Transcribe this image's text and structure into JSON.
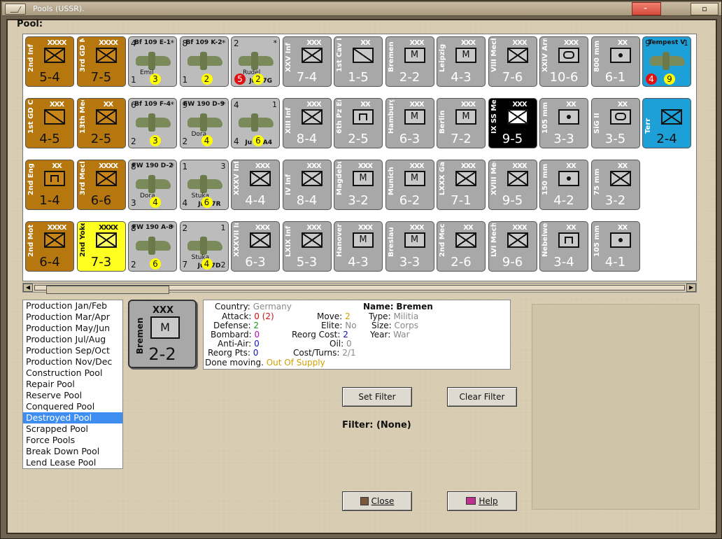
{
  "window": {
    "title": "Pools (USSR)."
  },
  "pool_header": "Pool:",
  "rows": [
    [
      {
        "t": "unit",
        "color": "c-brown",
        "size": "XXXX",
        "name": "2nd Inf",
        "sym": "x",
        "stats": "5-4"
      },
      {
        "t": "unit",
        "color": "c-brown",
        "size": "XXXX",
        "name": "3rd GD Mot",
        "sym": "x",
        "stats": "7-5"
      },
      {
        "t": "air",
        "name": "Bf 109\nE-1",
        "tl": "4",
        "tr": "*",
        "bl": "1",
        "an2": "Emil",
        "dot": "3",
        "dotc": "dy"
      },
      {
        "t": "air",
        "name": "Bf 109\nK-2",
        "tl": "8",
        "tr": "*",
        "bl": "1",
        "dot": "2",
        "dotc": "dy"
      },
      {
        "t": "air",
        "name": "",
        "tl": "2",
        "tr": "*",
        "bl": "",
        "an2": "Rudel",
        "an3": "Ju 87G",
        "dot": "2",
        "dotc": "dy",
        "dot2": "5",
        "dot2c": "dr"
      },
      {
        "t": "unit",
        "color": "c-gray",
        "size": "XXX",
        "name": "XXV Inf",
        "sym": "x",
        "stats": "7-4"
      },
      {
        "t": "unit",
        "color": "c-gray",
        "size": "XX",
        "name": "1st Cav Div",
        "sym": "slash",
        "stats": "1-5"
      },
      {
        "t": "unit",
        "color": "c-gray",
        "size": "XXX",
        "name": "Bremen",
        "sym": "m",
        "stats": "2-2"
      },
      {
        "t": "unit",
        "color": "c-gray",
        "size": "XXX",
        "name": "Leipzig",
        "sym": "m",
        "stats": "4-3"
      },
      {
        "t": "unit",
        "color": "c-gray",
        "size": "XXX",
        "name": "VIII Mech",
        "sym": "x",
        "stats": "7-6"
      },
      {
        "t": "unit",
        "color": "c-gray",
        "size": "XXX",
        "name": "XXIV Arm",
        "sym": "o",
        "stats": "10-6"
      },
      {
        "t": "unit",
        "color": "c-gray",
        "size": "XX",
        "name": "800 mm G.",
        "sym": "dot",
        "stats": "6-1"
      },
      {
        "t": "air",
        "color": "c-blue",
        "name": "Tempest\nV",
        "tl": "9",
        "tr": "1",
        "dot": "9",
        "dotc": "dy",
        "dot2": "4",
        "dot2c": "dr"
      }
    ],
    [
      {
        "t": "unit",
        "color": "c-brown",
        "size": "XXX",
        "name": "1st GD Cav",
        "sym": "slash",
        "stats": "4-5"
      },
      {
        "t": "unit",
        "color": "c-brown",
        "size": "XX",
        "name": "13th Mech.",
        "sym": "x",
        "stats": "2-5"
      },
      {
        "t": "air",
        "name": "Bf 109\nF-4",
        "tl": "6",
        "tr": "*",
        "bl": "2",
        "dot": "3",
        "dotc": "dy"
      },
      {
        "t": "air",
        "name": "FW 190\nD-9",
        "tl": "9",
        "tr": "*",
        "bl": "2",
        "an2": "Dora",
        "dot": "4",
        "dotc": "dy"
      },
      {
        "t": "air",
        "name": "",
        "tl": "4",
        "tr": "1",
        "bl": "4",
        "an3": "Ju 88A4",
        "dot": "6",
        "dotc": "dy"
      },
      {
        "t": "unit",
        "color": "c-gray",
        "size": "XXX",
        "name": "XIII Inf",
        "sym": "x",
        "stats": "8-4"
      },
      {
        "t": "unit",
        "color": "c-gray",
        "size": "XX",
        "name": "6th Pz Eng",
        "sym": "e",
        "stats": "2-5"
      },
      {
        "t": "unit",
        "color": "c-gray",
        "size": "XXX",
        "name": "Hamburg",
        "sym": "m",
        "stats": "6-3"
      },
      {
        "t": "unit",
        "color": "c-gray",
        "size": "XXX",
        "name": "Berlin",
        "sym": "m",
        "stats": "7-2"
      },
      {
        "t": "unit",
        "color": "c-black",
        "size": "XXX",
        "name": "IX SS Mech",
        "sym": "x",
        "stats": "9-5"
      },
      {
        "t": "unit",
        "color": "c-gray",
        "size": "XX",
        "name": "105 mm",
        "sym": "dot",
        "stats": "3-3"
      },
      {
        "t": "unit",
        "color": "c-gray",
        "size": "XX",
        "name": "SiG II",
        "sym": "o",
        "stats": "3-5"
      },
      {
        "t": "unit",
        "color": "c-blue",
        "size": "",
        "name": "Terr",
        "sym": "x",
        "stats": "2-4"
      }
    ],
    [
      {
        "t": "unit",
        "color": "c-brown",
        "size": "XX",
        "name": "2nd Eng",
        "sym": "e",
        "stats": "1-4"
      },
      {
        "t": "unit",
        "color": "c-brown",
        "size": "XXXX",
        "name": "3rd Mech",
        "sym": "x",
        "stats": "6-6"
      },
      {
        "t": "air",
        "name": "FW 190\nD-2",
        "tl": "8",
        "tr": "*",
        "bl": "3",
        "an2": "Dora",
        "dot": "4",
        "dotc": "dy"
      },
      {
        "t": "air",
        "name": "",
        "tl": "1",
        "tr": "3",
        "bl": "4",
        "an2": "Stuka",
        "an3": "Ju 87R",
        "dot": "6",
        "dotc": "dy"
      },
      {
        "t": "unit",
        "color": "c-gray",
        "size": "XXX",
        "name": "XXXV Inf",
        "sym": "x",
        "stats": "4-4"
      },
      {
        "t": "unit",
        "color": "c-gray",
        "size": "XXX",
        "name": "IV Inf",
        "sym": "x",
        "stats": "8-4"
      },
      {
        "t": "unit",
        "color": "c-gray",
        "size": "XXX",
        "name": "Magdeburg",
        "sym": "m",
        "stats": "3-2"
      },
      {
        "t": "unit",
        "color": "c-gray",
        "size": "XXX",
        "name": "Munich",
        "sym": "m",
        "stats": "6-2"
      },
      {
        "t": "unit",
        "color": "c-gray",
        "size": "XXX",
        "name": "LXXX Garr",
        "sym": "x",
        "stats": "7-1"
      },
      {
        "t": "unit",
        "color": "c-gray",
        "size": "XXX",
        "name": "XVIII Mech",
        "sym": "x",
        "stats": "9-5"
      },
      {
        "t": "unit",
        "color": "c-gray",
        "size": "XX",
        "name": "150 mm",
        "sym": "dot",
        "stats": "4-2"
      },
      {
        "t": "unit",
        "color": "c-gray",
        "size": "XX",
        "name": "75 mm",
        "sym": "x",
        "stats": "3-2"
      }
    ],
    [
      {
        "t": "unit",
        "color": "c-brown",
        "size": "XXXX",
        "name": "2nd Mot",
        "sym": "x",
        "stats": "6-4"
      },
      {
        "t": "unit",
        "color": "c-yellow",
        "size": "XXXX",
        "name": "2nd Yoke",
        "sym": "x",
        "stats": "7-3"
      },
      {
        "t": "air",
        "name": "FW 190\nA-8",
        "tl": "8",
        "tr": "*",
        "bl": "2",
        "dot": "6",
        "dotc": "dy"
      },
      {
        "t": "air",
        "name": "",
        "tl": "2",
        "tr": "1",
        "bl": "7",
        "br": "2",
        "an2": "Stuka",
        "an3": "Ju 87D",
        "dot": "4",
        "dotc": "dy"
      },
      {
        "t": "unit",
        "color": "c-gray",
        "size": "XXX",
        "name": "XXXVII Inf",
        "sym": "x",
        "stats": "6-3"
      },
      {
        "t": "unit",
        "color": "c-gray",
        "size": "XXX",
        "name": "LXIX Inf",
        "sym": "x",
        "stats": "5-3"
      },
      {
        "t": "unit",
        "color": "c-gray",
        "size": "XXX",
        "name": "Hanover",
        "sym": "m",
        "stats": "4-3"
      },
      {
        "t": "unit",
        "color": "c-gray",
        "size": "XXX",
        "name": "Breslau",
        "sym": "m",
        "stats": "3-3"
      },
      {
        "t": "unit",
        "color": "c-gray",
        "size": "XX",
        "name": "2nd Mech .",
        "sym": "x",
        "stats": "2-6"
      },
      {
        "t": "unit",
        "color": "c-gray",
        "size": "XXX",
        "name": "LVI Mech",
        "sym": "x",
        "stats": "9-6"
      },
      {
        "t": "unit",
        "color": "c-gray",
        "size": "XX",
        "name": "Nebelwerf.",
        "sym": "e",
        "stats": "3-4"
      },
      {
        "t": "unit",
        "color": "c-gray",
        "size": "XX",
        "name": "105 mm",
        "sym": "dot",
        "stats": "4-1"
      }
    ]
  ],
  "pool_list": [
    "Production Jan/Feb",
    "Production Mar/Apr",
    "Production May/Jun",
    "Production Jul/Aug",
    "Production Sep/Oct",
    "Production Nov/Dec",
    "Construction Pool",
    "Repair Pool",
    "Reserve Pool",
    "Conquered Pool",
    "Destroyed Pool",
    "Scrapped Pool",
    "Force Pools",
    "Break Down Pool",
    "Lend Lease Pool"
  ],
  "pool_selected": "Destroyed Pool",
  "selected_unit": {
    "size": "XXX",
    "name": "Bremen",
    "sym": "M",
    "stats": "2-2"
  },
  "info": {
    "country_label": "Country:",
    "country": "Germany",
    "attack_label": "Attack:",
    "attack": "0",
    "attack_paren": "(2)",
    "defense_label": "Defense:",
    "defense": "2",
    "bombard_label": "Bombard:",
    "bombard": "0",
    "antiair_label": "Anti-Air:",
    "antiair": "0",
    "reorgpts_label": "Reorg Pts:",
    "reorgpts": "0",
    "move_label": "Move:",
    "move": "2",
    "elite_label": "Elite:",
    "elite": "No",
    "reorgcost_label": "Reorg Cost:",
    "reorgcost": "2",
    "oil_label": "Oil:",
    "oil": "0",
    "costturns_label": "Cost/Turns:",
    "costturns": "2/1",
    "name_label": "Name:",
    "name": "Bremen",
    "type_label": "Type:",
    "type": "Militia",
    "size_label": "Size:",
    "size": "Corps",
    "year_label": "Year:",
    "year": "War",
    "done_moving": "Done moving.",
    "supply": "Out Of Supply"
  },
  "buttons": {
    "set_filter": "Set Filter",
    "clear_filter": "Clear Filter",
    "close": "Close",
    "help": "Help"
  },
  "filter_text": "Filter: (None)"
}
